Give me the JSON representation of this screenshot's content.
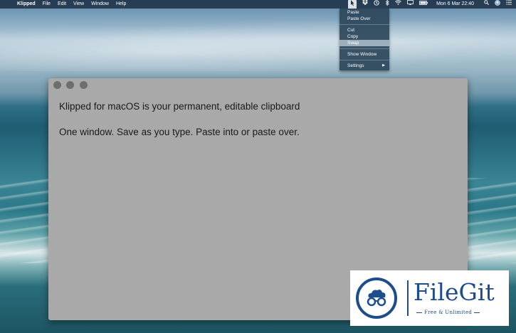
{
  "menubar": {
    "apple": "",
    "app_name": "Klipped",
    "menus": [
      "File",
      "Edit",
      "View",
      "Window",
      "Help"
    ],
    "clock": "Mon 6 Mar  22:40"
  },
  "dropdown": {
    "paste": "Paste",
    "paste_over": "Paste Over",
    "cut": "Cut",
    "copy": "Copy",
    "swap": "Swap",
    "show_window": "Show Window",
    "settings": "Settings",
    "settings_arrow": "▶"
  },
  "window": {
    "line1": "Klipped for macOS is your permanent, editable clipboard",
    "line2": "One window. Save as you type. Paste into or paste over."
  },
  "watermark": {
    "brand": "FileGit",
    "tagline": "Free & Unlimited",
    "color": "#1e4d8c"
  }
}
